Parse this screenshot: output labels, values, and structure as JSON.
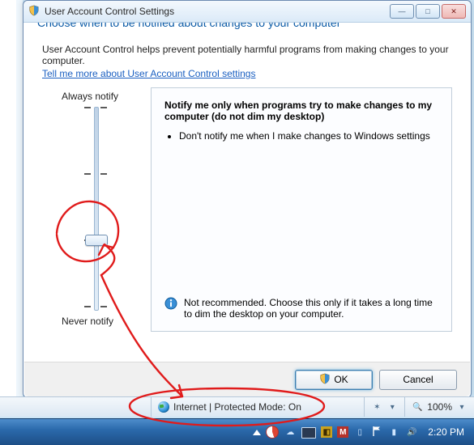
{
  "window": {
    "title": "User Account Control Settings",
    "heading_cut": "Choose when to be notified about changes to your computer",
    "description": "User Account Control helps prevent potentially harmful programs from making changes to your computer.",
    "help_link": "Tell me more about User Account Control settings",
    "slider": {
      "top_label": "Always notify",
      "bottom_label": "Never notify"
    },
    "level": {
      "title": "Notify me only when programs try to make changes to my computer (do not dim my desktop)",
      "bullet1": "Don't notify me when I make changes to Windows settings",
      "recommendation": "Not recommended. Choose this only if it takes a long time to dim the desktop on your computer."
    },
    "buttons": {
      "ok": "OK",
      "cancel": "Cancel"
    }
  },
  "ie_status": {
    "zone_text": "Internet | Protected Mode: On",
    "zoom": "100%"
  },
  "taskbar": {
    "clock": "2:20 PM"
  }
}
